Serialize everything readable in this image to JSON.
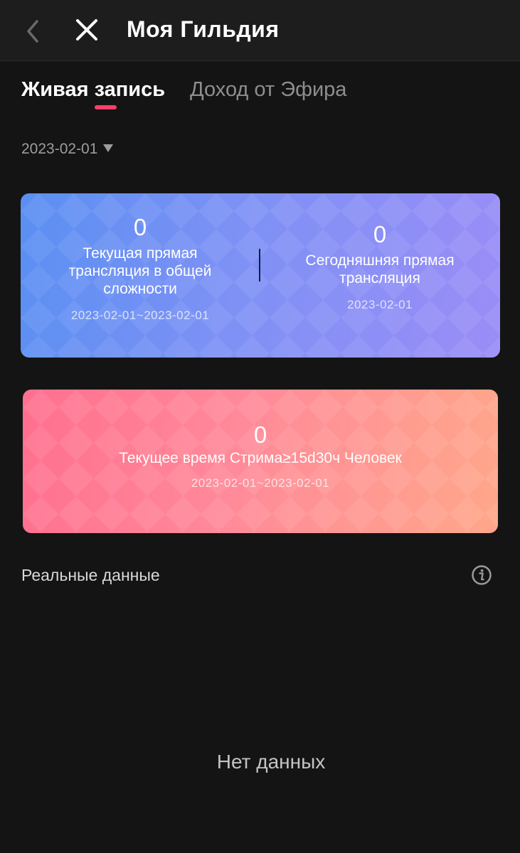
{
  "header": {
    "title": "Моя Гильдия"
  },
  "tabs": [
    {
      "label": "Живая запись",
      "active": true
    },
    {
      "label": "Доход от Эфира",
      "active": false
    }
  ],
  "date_filter": {
    "value": "2023-02-01"
  },
  "card_live": {
    "total": {
      "value": "0",
      "label": "Текущая прямая трансляция в общей сложности",
      "range": "2023-02-01~2023-02-01"
    },
    "today": {
      "value": "0",
      "label": "Сегодняшняя прямая трансляция",
      "date": "2023-02-01"
    }
  },
  "card_stream_time": {
    "value": "0",
    "label": "Текущее время Стрима≥15d30ч Человек",
    "range": "2023-02-01~2023-02-01"
  },
  "realtime": {
    "title": "Реальные данные",
    "empty_text": "Нет данных"
  },
  "icons": {
    "back": "chevron-left-icon",
    "close": "close-icon",
    "info": "info-icon",
    "dropdown": "triangle-down-icon"
  },
  "colors": {
    "background": "#141414",
    "header": "#1d1d1d",
    "accent": "#ff3d68",
    "card_blue_start": "#5a8ff2",
    "card_blue_end": "#9a8df6",
    "card_pink_start": "#ff6f8f",
    "card_pink_end": "#ffa78a"
  }
}
